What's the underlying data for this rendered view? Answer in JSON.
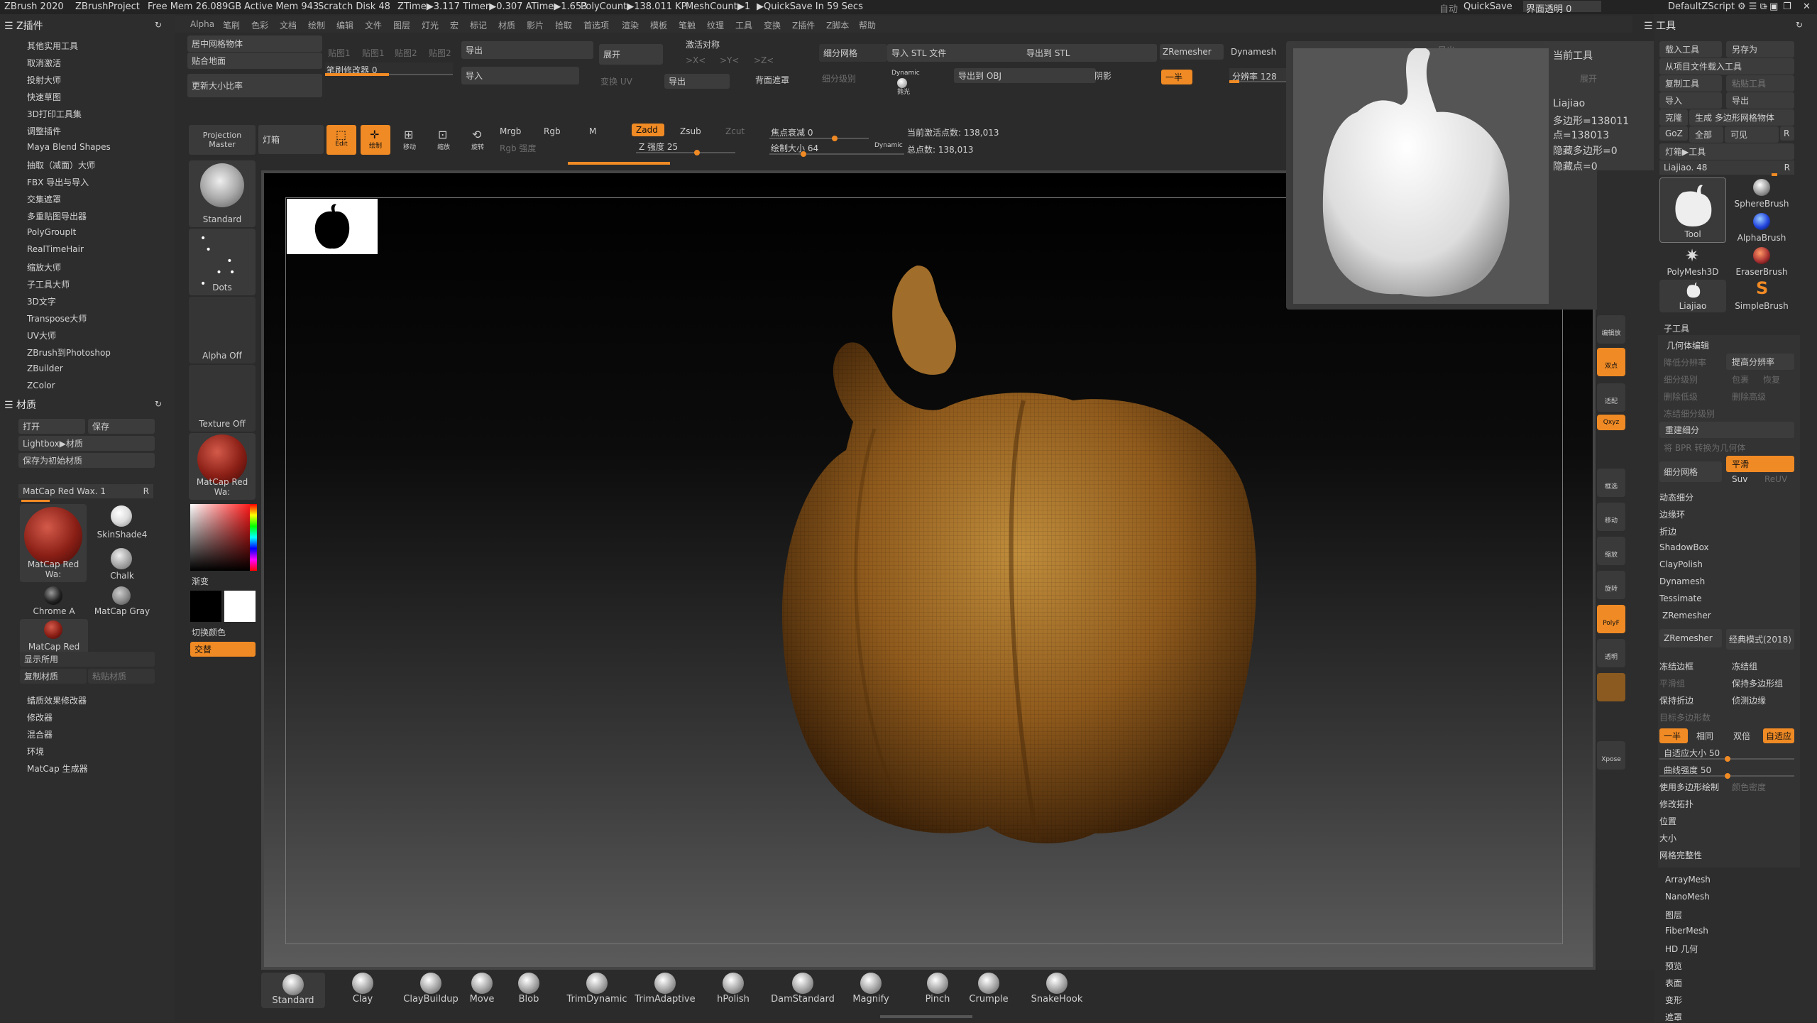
{
  "titlebar": {
    "app": "ZBrush 2020",
    "project": "ZBrushProject",
    "free_mem": "Free Mem 26.089GB",
    "active_mem": "Active Mem 943",
    "scratch": "Scratch Disk 48",
    "ztime": "ZTime▶3.117 Timer▶0.307 ATime▶1.653",
    "polycount": "PolyCount▶138.011 KP",
    "meshcount": "MeshCount▶1",
    "quicksave_timer": "▶QuickSave In 59 Secs",
    "auto": "自动",
    "quicksave": "QuickSave",
    "ui_transparency": "界面透明 0",
    "script": "DefaultZScript"
  },
  "menu": [
    "Alpha",
    "笔刷",
    "色彩",
    "文档",
    "绘制",
    "编辑",
    "文件",
    "图层",
    "灯光",
    "宏",
    "标记",
    "材质",
    "影片",
    "拾取",
    "首选项",
    "渲染",
    "模板",
    "笔触",
    "纹理",
    "工具",
    "变换",
    "Z插件",
    "Z脚本",
    "帮助"
  ],
  "left_panel": {
    "zplugin_title": "Z插件",
    "zplugins": [
      "其他实用工具",
      "取消激活",
      "投射大师",
      "快速草图",
      "3D打印工具集",
      "调整插件",
      "Maya Blend Shapes",
      "抽取（减面）大师",
      "FBX 导出与导入",
      "交集遮罩",
      "多重贴图导出器",
      "PolyGroupIt",
      "RealTimeHair",
      "缩放大师",
      "子工具大师",
      "3D文字",
      "Transpose大师",
      "UV大师",
      "ZBrush到Photoshop",
      "ZBuilder",
      "ZColor"
    ],
    "material_title": "材质",
    "open": "打开",
    "save": "保存",
    "lightbox": "Lightbox▶材质",
    "save_default": "保存为初始材质",
    "current_mat": "MatCap Red Wax. 1",
    "r": "R",
    "mat_big_label": "MatCap Red Wa:",
    "mats": [
      "SkinShade4",
      "Chalk",
      "Chrome A",
      "MatCap Gray",
      "MatCap Red Wa:"
    ],
    "show_used": "显示所用",
    "copy_mat": "复制材质",
    "paste_mat": "粘贴材质",
    "bottom_items": [
      "蜡质效果修改器",
      "修改器",
      "混合器",
      "环境",
      "MatCap 生成器"
    ]
  },
  "top_shelf": {
    "center_mesh": "居中网格物体",
    "stick_floor": "贴合地面",
    "update_size": "更新大小比率",
    "brush1": "贴图1",
    "brush2": "贴图1",
    "brush3": "贴图2",
    "brush4": "贴图2",
    "brush_modifier": "笔刷修改器 0",
    "export": "导出",
    "import": "导入",
    "unfold": "展开",
    "unfold_uv": "变换 UV",
    "export2": "导出",
    "activate_symmetry": "激活对称",
    "sym_x": ">X<",
    "sym_y": ">Y<",
    "sym_z": ">Z<",
    "backface_mask": "背面遮罩",
    "divide": "细分网格",
    "divide_level": "细分级别",
    "dynamic_label": "Dynamic",
    "smooth_label": "抛光",
    "import_stl": "导入 STL 文件",
    "export_stl": "导出到 STL",
    "export_obj": "导出到 OBJ",
    "shadow": "阴影",
    "zremesher": "ZRemesher",
    "dynamesh": "Dynamesh",
    "half": "一半",
    "resolution": "分辨率 128",
    "projection_master": "Projection Master",
    "lightbox": "灯箱",
    "edit": "Edit",
    "draw": "绘制",
    "move": "移动",
    "scale": "缩放",
    "rotate": "旋转",
    "mrgb": "Mrgb",
    "rgb": "Rgb",
    "m": "M",
    "rgb_intensity": "Rgb 强度",
    "zadd": "Zadd",
    "zsub": "Zsub",
    "zcut": "Zcut",
    "z_intensity": "Z 强度 25",
    "focal_shift": "焦点衰减 0",
    "draw_size": "绘制大小 64",
    "dynamic": "Dynamic",
    "active_points": "当前激活点数: 138,013",
    "total_points": "总点数: 138,013",
    "export_dim": "导出"
  },
  "tool_strip": {
    "items": [
      "Standard",
      "Dots",
      "Alpha Off",
      "Texture Off",
      "MatCap Red Wa:"
    ],
    "gradient": "渐变",
    "switch_color": "切换颜色",
    "alternate": "交替"
  },
  "preview": {
    "title": "当前工具",
    "name": "Liajiao",
    "polys": "多边形=138011",
    "points": "点=138013",
    "hidden_polys": "隐藏多边形=0",
    "hidden_points": "隐藏点=0",
    "unfold": "展开"
  },
  "right_icons": [
    "编辑放",
    "双点",
    "适配",
    "Qxyz",
    "框选",
    "移动",
    "缩放",
    "旋转",
    "PolyF",
    "透明",
    "",
    "Xpose"
  ],
  "right_panel": {
    "title": "工具",
    "load_tool": "载入工具",
    "save_as": "另存为",
    "load_from_project": "从项目文件载入工具",
    "copy_tool": "复制工具",
    "paste_tool": "粘贴工具",
    "import": "导入",
    "export": "导出",
    "clone": "克隆",
    "make_polymesh": "生成 多边形网格物体",
    "goz": "GoZ",
    "all": "全部",
    "visible": "可见",
    "r": "R",
    "lightbox_tools": "灯箱▶工具",
    "current_tool": "Liajiao. 48",
    "tools": [
      "Tool",
      "SphereBrush",
      "AlphaBrush",
      "PolyMesh3D",
      "EraserBrush",
      "Liajiao",
      "SimpleBrush"
    ],
    "subtool": "子工具",
    "geometry": "几何体编辑",
    "lower_res": "降低分辨率",
    "higher_res": "提高分辨率",
    "sdiv": "细分级别",
    "del_lower": "删除低级",
    "del_higher": "删除高级",
    "freeze_sdiv": "冻结细分级别",
    "reconstruct": "重建细分",
    "bpr_to_geo": "将 BPR 转换为几何体",
    "divide": "细分网格",
    "smooth": "平滑",
    "suv": "Suv",
    "reuv": "ReUV",
    "dynamic_subdiv": "动态细分",
    "edge_loop": "边缘环",
    "crease": "折边",
    "shadowbox": "ShadowBox",
    "claypolish": "ClayPolish",
    "dynamesh": "Dynamesh",
    "tessimate": "Tessimate",
    "zremesher_section": "ZRemesher",
    "zremesher_btn": "ZRemesher",
    "legacy": "经典模式(2018)",
    "freeze_border": "冻结边框",
    "freeze_groups": "冻结组",
    "smooth_groups": "平滑组",
    "keep_groups": "保持多边形组",
    "keep_creases": "保持折边",
    "detect_edges": "侦测边缘",
    "target_polys": "目标多边形数",
    "half": "一半",
    "same": "相同",
    "double": "双倍",
    "adaptive": "自适应",
    "adaptive_size": "自适应大小 50",
    "curve_strength": "曲线强度 50",
    "use_polypaint": "使用多边形绘制",
    "color_density": "颜色密度",
    "modify_topology": "修改拓扑",
    "position": "位置",
    "size": "大小",
    "mesh_integrity": "网格完整性",
    "arraymesh": "ArrayMesh",
    "nanomesh": "NanoMesh",
    "layers": "图层",
    "fibermesh": "FiberMesh",
    "hd_geometry": "HD 几何",
    "preview": "预览",
    "surface": "表面",
    "deformation": "变形",
    "masking": "遮罩"
  },
  "bottom_brushes": [
    "Standard",
    "Clay",
    "ClayBuildup",
    "Move",
    "Blob",
    "TrimDynamic",
    "TrimAdaptive",
    "hPolish",
    "DamStandard",
    "Magnify",
    "Pinch",
    "Crumple",
    "SnakeHook"
  ]
}
